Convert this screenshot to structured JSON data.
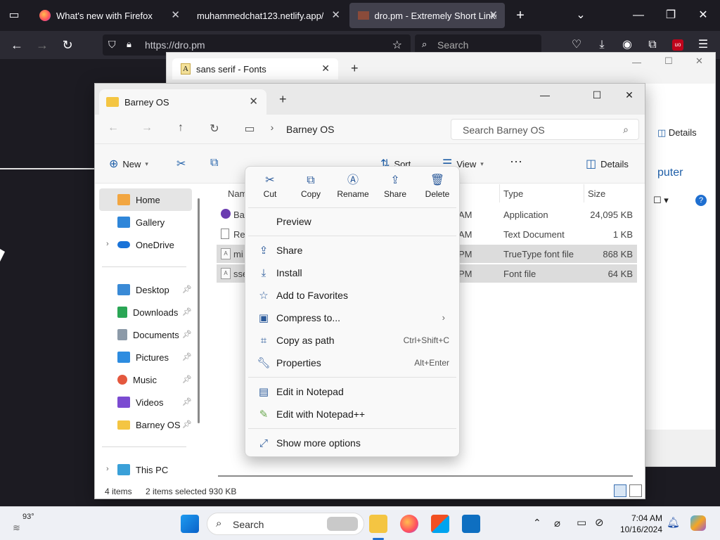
{
  "firefox": {
    "tabs": [
      {
        "title": "What's new with Firefox"
      },
      {
        "title": "muhammedchat123.netlify.app/"
      },
      {
        "title": "dro.pm - Extremely Short Links"
      }
    ],
    "url": "https://dro.pm",
    "search_placeholder": "Search"
  },
  "fonts_window": {
    "tab_title": "sans serif - Fonts",
    "details_label": "Details",
    "partial_text": "puter"
  },
  "explorer": {
    "tab_title": "Barney OS",
    "address": "Barney OS",
    "search_placeholder": "Search Barney OS",
    "commands": {
      "new": "New",
      "sort": "Sort",
      "view": "View",
      "details": "Details"
    },
    "sidebar": {
      "home": "Home",
      "gallery": "Gallery",
      "onedrive": "OneDrive",
      "desktop": "Desktop",
      "downloads": "Downloads",
      "documents": "Documents",
      "pictures": "Pictures",
      "music": "Music",
      "videos": "Videos",
      "barney": "Barney OS",
      "thispc": "This PC"
    },
    "columns": {
      "name": "Name",
      "type": "Type",
      "size": "Size"
    },
    "rows": [
      {
        "name": "Bar",
        "time": "AM",
        "type": "Application",
        "size": "24,095 KB"
      },
      {
        "name": "Rea",
        "time": "AM",
        "type": "Text Document",
        "size": "1 KB"
      },
      {
        "name": "mi",
        "time": "PM",
        "type": "TrueType font file",
        "size": "868 KB"
      },
      {
        "name": "sse",
        "time": "PM",
        "type": "Font file",
        "size": "64 KB"
      }
    ],
    "status": {
      "items": "4 items",
      "selected": "2 items selected",
      "size": "930 KB"
    }
  },
  "context_menu": {
    "toolbar": {
      "cut": "Cut",
      "copy": "Copy",
      "rename": "Rename",
      "share": "Share",
      "delete": "Delete"
    },
    "preview": "Preview",
    "share": "Share",
    "install": "Install",
    "favorites": "Add to Favorites",
    "compress": "Compress to...",
    "copy_path": "Copy as path",
    "copy_path_shortcut": "Ctrl+Shift+C",
    "properties": "Properties",
    "properties_shortcut": "Alt+Enter",
    "notepad": "Edit in Notepad",
    "notepadpp": "Edit with Notepad++",
    "more": "Show more options"
  },
  "taskbar": {
    "weather": "93°",
    "search_placeholder": "Search",
    "time": "7:04 AM",
    "date": "10/16/2024"
  }
}
